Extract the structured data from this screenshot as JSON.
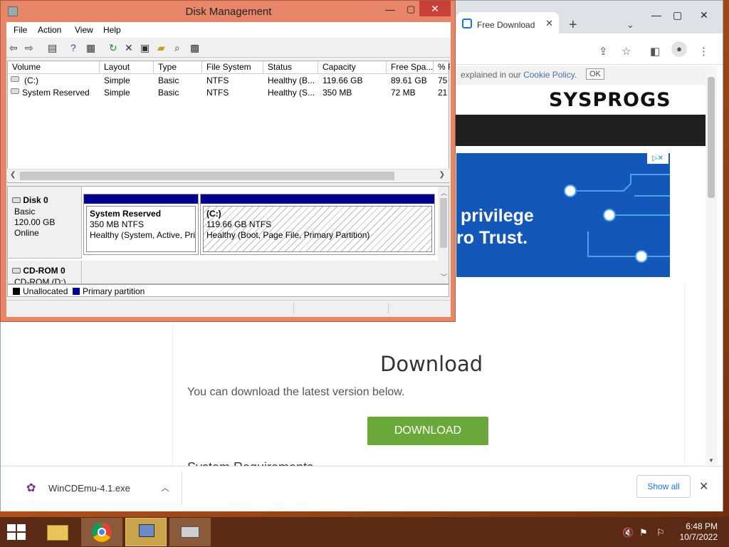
{
  "browser": {
    "tab_title": "Free Download",
    "tab_close": "✕",
    "new_tab": "+",
    "cookie_text": "explained in our",
    "cookie_link": "Cookie Policy.",
    "cookie_ok": "OK",
    "logo": "SYSPROGS",
    "ad_line1": "privilege",
    "ad_line2": "ro Trust.",
    "heading": "Download",
    "subheading": "You can download the latest version below.",
    "download_button": "DOWNLOAD",
    "section_partial": "System Requirements",
    "download_bar": {
      "filename": "WinCDEmu-4.1.exe",
      "show_all": "Show all"
    }
  },
  "disk_mgmt": {
    "title": "Disk Management",
    "menu": [
      "File",
      "Action",
      "View",
      "Help"
    ],
    "columns": [
      "Volume",
      "Layout",
      "Type",
      "File System",
      "Status",
      "Capacity",
      "Free Spa...",
      "% F"
    ],
    "rows": [
      [
        "(C:)",
        "Simple",
        "Basic",
        "NTFS",
        "Healthy (B...",
        "119.66 GB",
        "89.61 GB",
        "75"
      ],
      [
        "System Reserved",
        "Simple",
        "Basic",
        "NTFS",
        "Healthy (S...",
        "350 MB",
        "72 MB",
        "21"
      ]
    ],
    "disk0": {
      "name": "Disk 0",
      "type": "Basic",
      "size": "120.00 GB",
      "state": "Online"
    },
    "partitions": [
      {
        "name": "System Reserved",
        "size": "350 MB NTFS",
        "status": "Healthy (System, Active, Primary Partition)"
      },
      {
        "name": "(C:)",
        "size": "119.66 GB NTFS",
        "status": "Healthy (Boot, Page File, Primary Partition)"
      }
    ],
    "cdrom": {
      "name": "CD-ROM 0",
      "drive": "CD-ROM (D:)"
    },
    "legend": [
      "Unallocated",
      "Primary partition"
    ],
    "colors": {
      "unallocated": "#000000",
      "primary": "#00008b"
    }
  },
  "taskbar": {
    "time": "6:48 PM",
    "date": "10/7/2022"
  }
}
